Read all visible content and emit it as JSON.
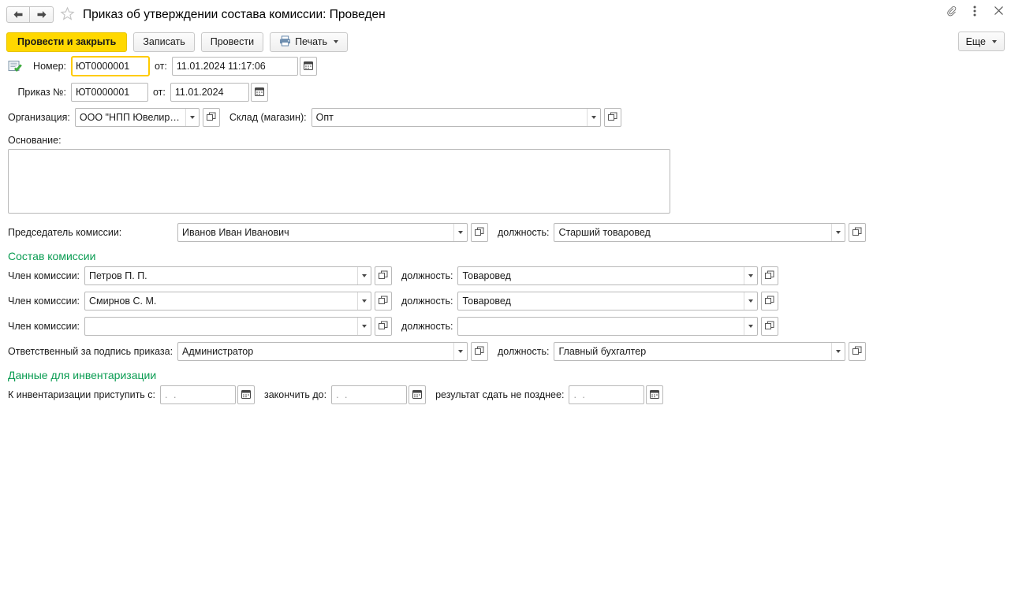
{
  "window": {
    "title": "Приказ об утверждении состава комиссии: Проведен",
    "back_icon": "arrow-left-icon",
    "forward_icon": "arrow-right-icon",
    "favorite_icon": "star-icon",
    "attachment_icon": "paperclip-icon",
    "menu_icon": "kebab-menu-icon",
    "close_icon": "close-icon"
  },
  "toolbar": {
    "post_and_close": "Провести и закрыть",
    "save": "Записать",
    "post": "Провести",
    "print": "Печать",
    "print_icon": "printer-icon",
    "more": "Еще",
    "accent_yellow": "#ffd800"
  },
  "form": {
    "status_icon": "document-posted-icon",
    "number": {
      "label": "Номер:",
      "value": "ЮТ0000001",
      "date_label": "от:",
      "date_value": "11.01.2024 11:17:06",
      "calendar_icon": "calendar-icon"
    },
    "order_number": {
      "label": "Приказ №:",
      "value": "ЮТ0000001",
      "date_label": "от:",
      "date_value": "11.01.2024",
      "calendar_icon": "calendar-icon"
    },
    "organization": {
      "label": "Организация:",
      "value": "ООО \"НПП ЮвелирСофт\"",
      "dropdown_icon": "chevron-down-icon",
      "open_icon": "open-window-icon"
    },
    "warehouse": {
      "label": "Склад (магазин):",
      "value": "Опт",
      "dropdown_icon": "chevron-down-icon",
      "open_icon": "open-window-icon"
    },
    "basis": {
      "label": "Основание:",
      "value": ""
    },
    "chairman": {
      "label": "Председатель комиссии:",
      "value": "Иванов Иван Иванович",
      "position_label": "должность:",
      "position_value": "Старший товаровед"
    },
    "commission_section": {
      "title": "Состав комиссии",
      "color": "#0a9c52",
      "member_label": "Член комиссии:",
      "position_label": "должность:",
      "members": [
        {
          "name": "Петров П.  П.",
          "position": "Товаровед"
        },
        {
          "name": "Смирнов С.  М.",
          "position": "Товаровед"
        },
        {
          "name": "",
          "position": ""
        }
      ]
    },
    "responsible": {
      "label": "Ответственный за подпись приказа:",
      "value": "Администратор",
      "position_label": "должность:",
      "position_value": "Главный бухгалтер"
    },
    "inventory_section": {
      "title": "Данные для инвентаризации",
      "color": "#0a9c52",
      "date_placeholder": ".  .",
      "fields": [
        {
          "label": "К инвентаризации приступить с:",
          "value": ""
        },
        {
          "label": "закончить до:",
          "value": ""
        },
        {
          "label": "результат сдать не позднее:",
          "value": ""
        }
      ]
    }
  }
}
